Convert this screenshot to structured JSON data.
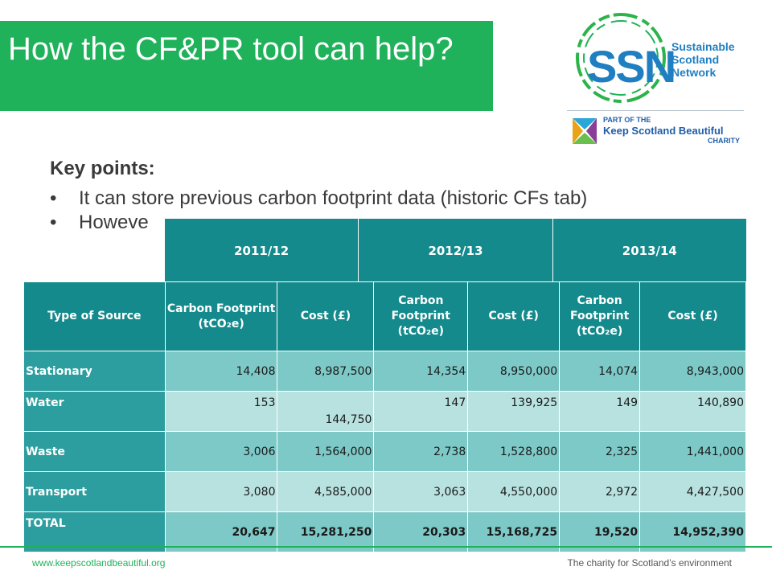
{
  "title": "How the CF&PR tool can help?",
  "logo": {
    "ssn": "SSN",
    "tagline": [
      "Sustainable",
      "Scotland",
      "Network"
    ],
    "part_of": "PART OF THE",
    "ksb": "Keep Scotland Beautiful",
    "charity": "CHARITY"
  },
  "key_points": {
    "heading": "Key points:",
    "bullet_symbol": "•",
    "items": [
      "It can store previous carbon footprint data (historic CFs tab)",
      "Howeve"
    ]
  },
  "table": {
    "years": [
      "2011/12",
      "2012/13",
      "2013/14"
    ],
    "headers": [
      "Type of Source",
      "Carbon Footprint (tCO₂e)",
      "Cost (£)",
      "Carbon Footprint (tCO₂e)",
      "Cost (£)",
      "Carbon Footprint (tCO₂e)",
      "Cost (£)"
    ],
    "rows": [
      {
        "label": "Stationary",
        "values": [
          "14,408",
          "8,987,500",
          "14,354",
          "8,950,000",
          "14,074",
          "8,943,000"
        ]
      },
      {
        "label": "Water",
        "values": [
          "153",
          "144,750",
          "147",
          "139,925",
          "149",
          "140,890"
        ]
      },
      {
        "label": "Waste",
        "values": [
          "3,006",
          "1,564,000",
          "2,738",
          "1,528,800",
          "2,325",
          "1,441,000"
        ]
      },
      {
        "label": "Transport",
        "values": [
          "3,080",
          "4,585,000",
          "3,063",
          "4,550,000",
          "2,972",
          "4,427,500"
        ]
      },
      {
        "label": "TOTAL",
        "values": [
          "20,647",
          "15,281,250",
          "20,303",
          "15,168,725",
          "19,520",
          "14,952,390"
        ]
      }
    ]
  },
  "footer": {
    "url": "www.keepscotlandbeautiful.org",
    "tagline": "The charity for Scotland’s environment"
  },
  "colors": {
    "brand_green": "#1fb25a",
    "table_teal": "#148a8c",
    "row_light": "#7dc9c7",
    "ssn_blue": "#1f7fc1"
  }
}
